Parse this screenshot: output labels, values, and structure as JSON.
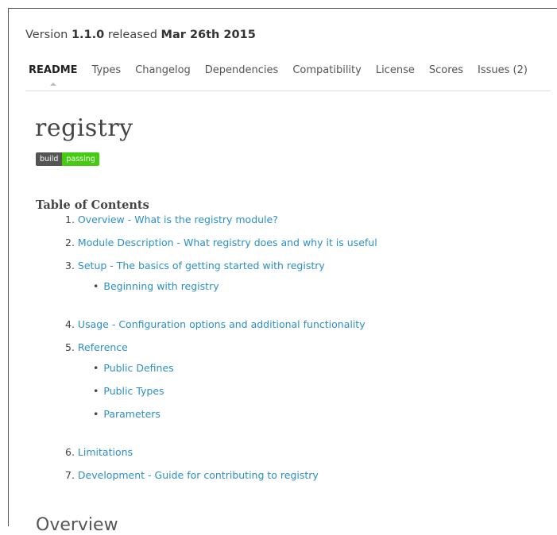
{
  "version_line": {
    "prefix": "Version",
    "version": "1.1.0",
    "middle": "released",
    "date": "Mar 26th 2015"
  },
  "tabs": [
    "README",
    "Types",
    "Changelog",
    "Dependencies",
    "Compatibility",
    "License",
    "Scores",
    "Issues (2)"
  ],
  "active_tab": "README",
  "readme": {
    "title": "registry",
    "badge": {
      "left": "build",
      "right": "passing",
      "left_color": "#555555",
      "right_color": "#44cc11"
    },
    "toc_heading": "Table of Contents",
    "toc": {
      "i1": {
        "num": "1.",
        "text": "Overview - What is the registry module?"
      },
      "i2": {
        "num": "2.",
        "text": "Module Description - What registry does and why it is useful"
      },
      "i3": {
        "num": "3.",
        "text": "Setup - The basics of getting started with registry"
      },
      "i3a": {
        "bullet": "•",
        "text": "Beginning with registry"
      },
      "i4": {
        "num": "4.",
        "text": "Usage - Configuration options and additional functionality"
      },
      "i5": {
        "num": "5.",
        "text": "Reference"
      },
      "i5a": {
        "bullet": "•",
        "text": "Public Defines"
      },
      "i5b": {
        "bullet": "•",
        "text": "Public Types"
      },
      "i5c": {
        "bullet": "•",
        "text": "Parameters"
      },
      "i6": {
        "num": "6.",
        "text": "Limitations"
      },
      "i7": {
        "num": "7.",
        "text": "Development - Guide for contributing to registry"
      }
    },
    "section_heading": "Overview"
  },
  "colors": {
    "link": "#2b8fc6",
    "text": "#444444"
  }
}
